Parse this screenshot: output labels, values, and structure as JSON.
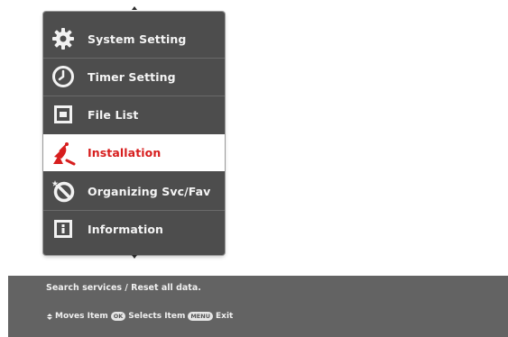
{
  "menu": {
    "items": [
      {
        "label": "System Setting",
        "icon": "gear-icon",
        "selected": false
      },
      {
        "label": "Timer Setting",
        "icon": "clock-icon",
        "selected": false
      },
      {
        "label": "File List",
        "icon": "file-list-icon",
        "selected": false
      },
      {
        "label": "Installation",
        "icon": "satellite-dish-icon",
        "selected": true
      },
      {
        "label": "Organizing Svc/Fav",
        "icon": "no-entry-star-icon",
        "selected": false
      },
      {
        "label": "Information",
        "icon": "info-icon",
        "selected": false
      }
    ]
  },
  "help": {
    "description": "Search services / Reset all data.",
    "moves_label": "Moves Item",
    "ok_key": "OK",
    "selects_label": "Selects Item",
    "menu_key": "MENU",
    "exit_label": "Exit"
  },
  "colors": {
    "panel_bg": "#4d4d4d",
    "selected_bg": "#ffffff",
    "selected_text": "#d71e1e",
    "help_bar_bg": "#636363"
  }
}
